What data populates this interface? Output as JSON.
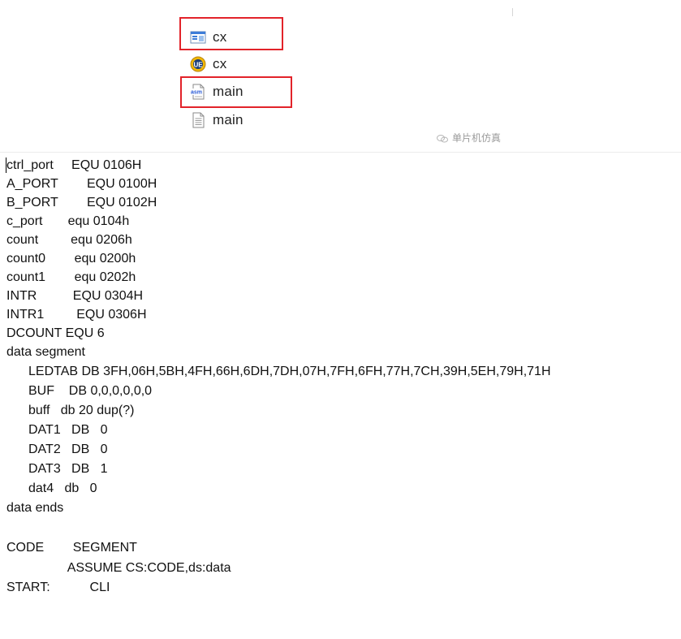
{
  "explorer": {
    "files": [
      {
        "name": "cx",
        "icon": "exe-window-icon"
      },
      {
        "name": "cx",
        "icon": "ue-project-icon"
      },
      {
        "name": "main",
        "icon": "asm-file-icon"
      },
      {
        "name": "main",
        "icon": "text-file-icon"
      }
    ],
    "highlight_color": "#e2232a",
    "watermark": "单片机仿真"
  },
  "code": {
    "lines": [
      "ctrl_port     EQU 0106H",
      "A_PORT        EQU 0100H",
      "B_PORT        EQU 0102H",
      "c_port       equ 0104h",
      "count         equ 0206h",
      "count0        equ 0200h",
      "count1        equ 0202h",
      "INTR          EQU 0304H",
      "INTR1         EQU 0306H",
      "DCOUNT EQU 6",
      "data segment",
      "LEDTAB DB 3FH,06H,5BH,4FH,66H,6DH,7DH,07H,7FH,6FH,77H,7CH,39H,5EH,79H,71H",
      "BUF    DB 0,0,0,0,0,0",
      "buff   db 20 dup(?)",
      "DAT1   DB   0",
      "DAT2   DB   0",
      "DAT3   DB   1",
      "dat4   db   0",
      "data ends",
      "",
      "CODE        SEGMENT",
      "                 ASSUME CS:CODE,ds:data",
      "START:           CLI"
    ]
  }
}
